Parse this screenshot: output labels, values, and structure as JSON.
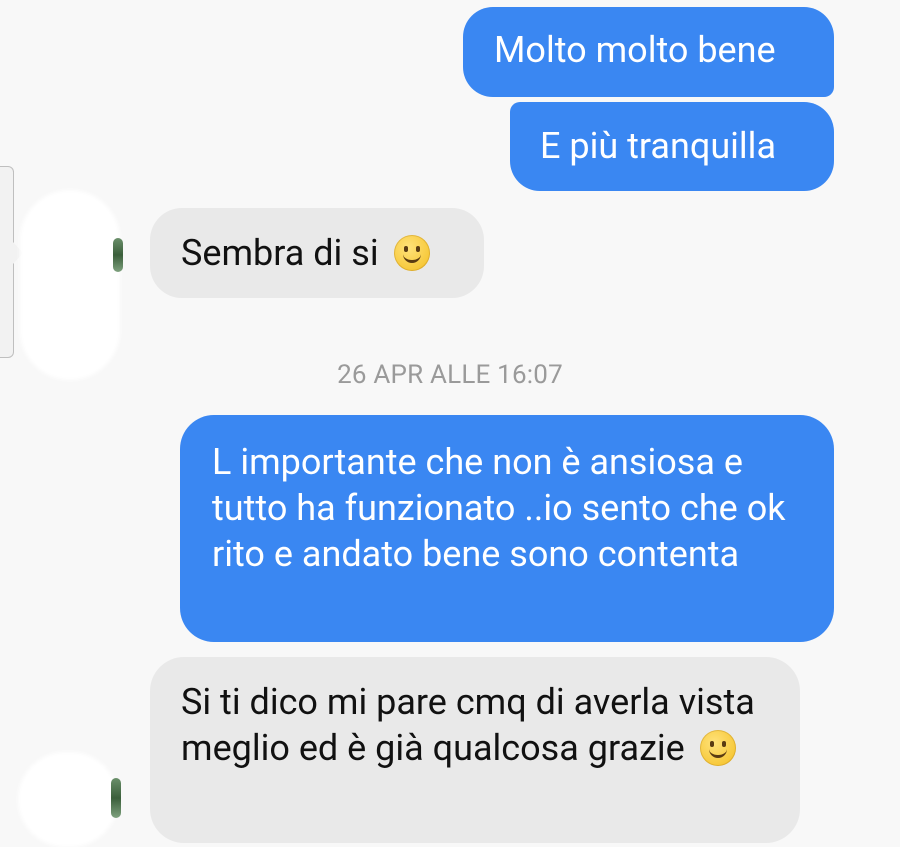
{
  "messages": [
    {
      "direction": "outgoing",
      "text": "Molto molto bene"
    },
    {
      "direction": "outgoing",
      "text": "E più tranquilla"
    },
    {
      "direction": "incoming",
      "text": "Sembra di si",
      "emoji": "slightly-smiling-face-icon"
    },
    {
      "direction": "outgoing",
      "text": "L importante che non è ansiosa e tutto ha funzionato ..io sento che ok rito e andato bene sono contenta"
    },
    {
      "direction": "incoming",
      "text": "Si ti dico mi pare cmq di averla vista meglio ed è già qualcosa grazie",
      "emoji": "slightly-smiling-face-icon"
    }
  ],
  "timestamp": "26 APR ALLE 16:07",
  "colors": {
    "outgoing_bubble": "#3a87f2",
    "incoming_bubble": "#e9e9e9",
    "background": "#f8f8f8",
    "timestamp_text": "#9a9a9a"
  }
}
